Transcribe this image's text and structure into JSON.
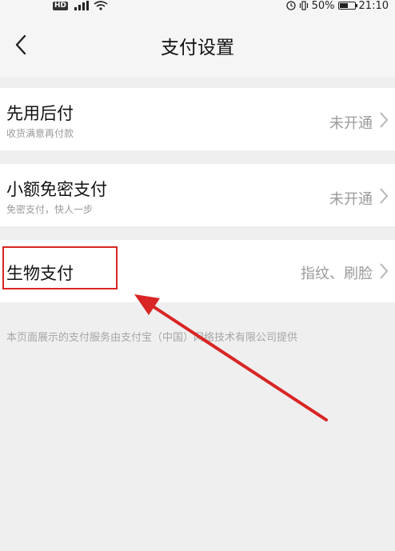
{
  "status_bar": {
    "left_badge": "HD",
    "battery": "50%",
    "time": "21:10"
  },
  "header": {
    "title": "支付设置"
  },
  "settings": [
    {
      "title": "先用后付",
      "subtitle": "收货满意再付款",
      "value": "未开通"
    },
    {
      "title": "小额免密支付",
      "subtitle": "免密支付，快人一步",
      "value": "未开通"
    },
    {
      "title": "生物支付",
      "value": "指纹、刷脸"
    }
  ],
  "footer": {
    "note": "本页面展示的支付服务由支付宝（中国）网络技术有限公司提供"
  },
  "colors": {
    "annotation": "#d92525",
    "background": "#efefef",
    "row": "#ffffff"
  }
}
